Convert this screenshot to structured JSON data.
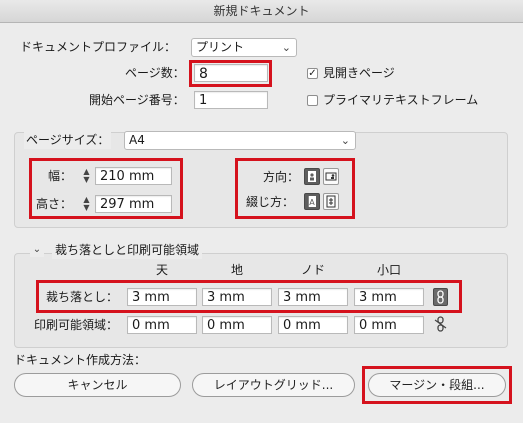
{
  "window": {
    "title": "新規ドキュメント"
  },
  "profile": {
    "label": "ドキュメントプロファイル：",
    "value": "プリント"
  },
  "pages": {
    "label": "ページ数：",
    "value": "8"
  },
  "start_page": {
    "label": "開始ページ番号：",
    "value": "1"
  },
  "facing_pages": {
    "label": "見開きページ",
    "checked": true
  },
  "primary_text_frame": {
    "label": "プライマリテキストフレーム",
    "checked": false
  },
  "page_size": {
    "label": "ページサイズ：",
    "value": "A4"
  },
  "width": {
    "label": "幅：",
    "value": "210 mm"
  },
  "height": {
    "label": "高さ：",
    "value": "297 mm"
  },
  "orientation": {
    "label": "方向：",
    "selected": "portrait"
  },
  "binding": {
    "label": "綴じ方：",
    "selected": "left-to-right"
  },
  "bleed_section": {
    "title": "裁ち落としと印刷可能領域",
    "columns": [
      "天",
      "地",
      "ノド",
      "小口"
    ],
    "bleed": {
      "label": "裁ち落とし：",
      "values": [
        "3 mm",
        "3 mm",
        "3 mm",
        "3 mm"
      ],
      "linked": true
    },
    "slug": {
      "label": "印刷可能領域：",
      "values": [
        "0 mm",
        "0 mm",
        "0 mm",
        "0 mm"
      ],
      "linked": false
    }
  },
  "create_method": {
    "label": "ドキュメント作成方法："
  },
  "buttons": {
    "cancel": "キャンセル",
    "layout_grid": "レイアウトグリッド...",
    "margins_columns": "マージン・段組..."
  },
  "colors": {
    "highlight": "#d5121d",
    "background": "#ececec",
    "selected_icon": "#5e5e5e"
  },
  "icons": {
    "select": "chevron-down-icon",
    "stepper": "stepper-icon",
    "link": "chain-link-icon",
    "unlink": "broken-chain-link-icon",
    "portrait": "portrait-orientation-icon",
    "landscape": "landscape-orientation-icon",
    "ltr_binding": "left-to-right-binding-icon",
    "rtl_binding": "right-to-left-binding-icon",
    "disclosure": "disclosure-chevron-icon"
  }
}
